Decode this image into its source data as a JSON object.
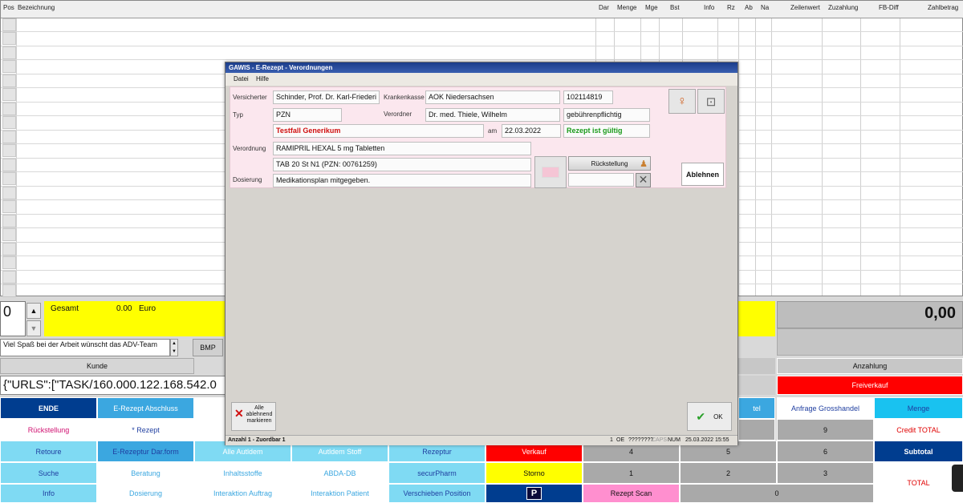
{
  "grid": {
    "headers": [
      "Pos",
      "Bezeichnung",
      "Dar",
      "Menge",
      "Mge",
      "Bst",
      "Info",
      "Rz",
      "Ab",
      "Na",
      "Zeilenwert",
      "Zuzahlung",
      "FB-Diff",
      "Zahlbetrag"
    ]
  },
  "dialog": {
    "title": "GAWIS - E-Rezept - Verordnungen",
    "menu": [
      "Datei",
      "Hilfe"
    ],
    "labels": {
      "versicherter": "Versicherter",
      "krankenkasse": "Krankenkasse",
      "typ": "Typ",
      "verordner": "Verordner",
      "am": "am",
      "verordnung": "Verordnung",
      "dosierung": "Dosierung"
    },
    "values": {
      "versicherter": "Schinder, Prof. Dr. Karl-Friederi",
      "krankenkasse": "AOK Niedersachsen",
      "kassen_nr": "102114819",
      "typ": "PZN",
      "verordner": "Dr. med. Thiele, Wilhelm",
      "gebuehr": "gebührenpflichtig",
      "testfall": "Testfall Generikum",
      "datum": "22.03.2022",
      "gueltig": "Rezept ist gültig",
      "verordnung": "RAMIPRIL HEXAL 5 mg Tabletten",
      "packung": "TAB 20 St N1 (PZN: 00761259)",
      "dosierung": "Medikationsplan mitgegeben."
    },
    "buttons": {
      "rueckstellung": "Rückstellung",
      "ablehnen": "Ablehnen",
      "alle_ablehnend_1": "Alle",
      "alle_ablehnend_2": "ablehnend",
      "alle_ablehnend_3": "markieren",
      "ok": "OK"
    },
    "status": {
      "left": "Anzahl 1 - Zuordbar 1",
      "right1": "1",
      "right2": "OE",
      "right3": "????????",
      "right4": "CAPS",
      "right5": "NUM",
      "right6": "25.03.2022",
      "right7": "15:55"
    }
  },
  "left_panel": {
    "qty": "0",
    "gesamt_label": "Gesamt",
    "gesamt_value": "0.00",
    "currency": "Euro",
    "ticker": "Viel Spaß bei der Arbeit wünscht das ADV-Team",
    "bmp": "BMP",
    "kunde": "Kunde",
    "urls": "{\"URLS\":[\"TASK/160.000.122.168.542.0"
  },
  "right_panel": {
    "total": "0,00",
    "anzahlung": "Anzahlung",
    "freiverkauf": "Freiverkauf"
  },
  "buttons": {
    "row1": [
      "ENDE",
      "E-Rezept Abschluss",
      "",
      "",
      "",
      "",
      "",
      "tel",
      "Anfrage Grosshandel",
      "Menge"
    ],
    "row2": [
      "Rückstellung",
      "* Rezept",
      "",
      "",
      "",
      "",
      "",
      "",
      "9",
      "Credit TOTAL"
    ],
    "row3": [
      "Retoure",
      "E-Rezeptur Dar.form",
      "Alle Autldem",
      "Autldem Stoff",
      "Rezeptur",
      "Verkauf",
      "4",
      "5",
      "6",
      "Subtotal"
    ],
    "row4": [
      "Suche",
      "Beratung",
      "Inhaltsstoffe",
      "ABDA-DB",
      "securPharm",
      "Storno",
      "1",
      "2",
      "3",
      "TOTAL"
    ],
    "row5": [
      "Info",
      "Dosierung",
      "Interaktion Auftrag",
      "Interaktion Patient",
      "Verschieben Position",
      "P",
      "Rezept Scan",
      "0"
    ]
  },
  "colors": {
    "navy": "#003d8f",
    "lightblue": "#7fdaf3",
    "yellow": "#ffff00",
    "red": "#ff0000",
    "pink": "#ff8fcf",
    "gray": "#a9a9a9"
  }
}
